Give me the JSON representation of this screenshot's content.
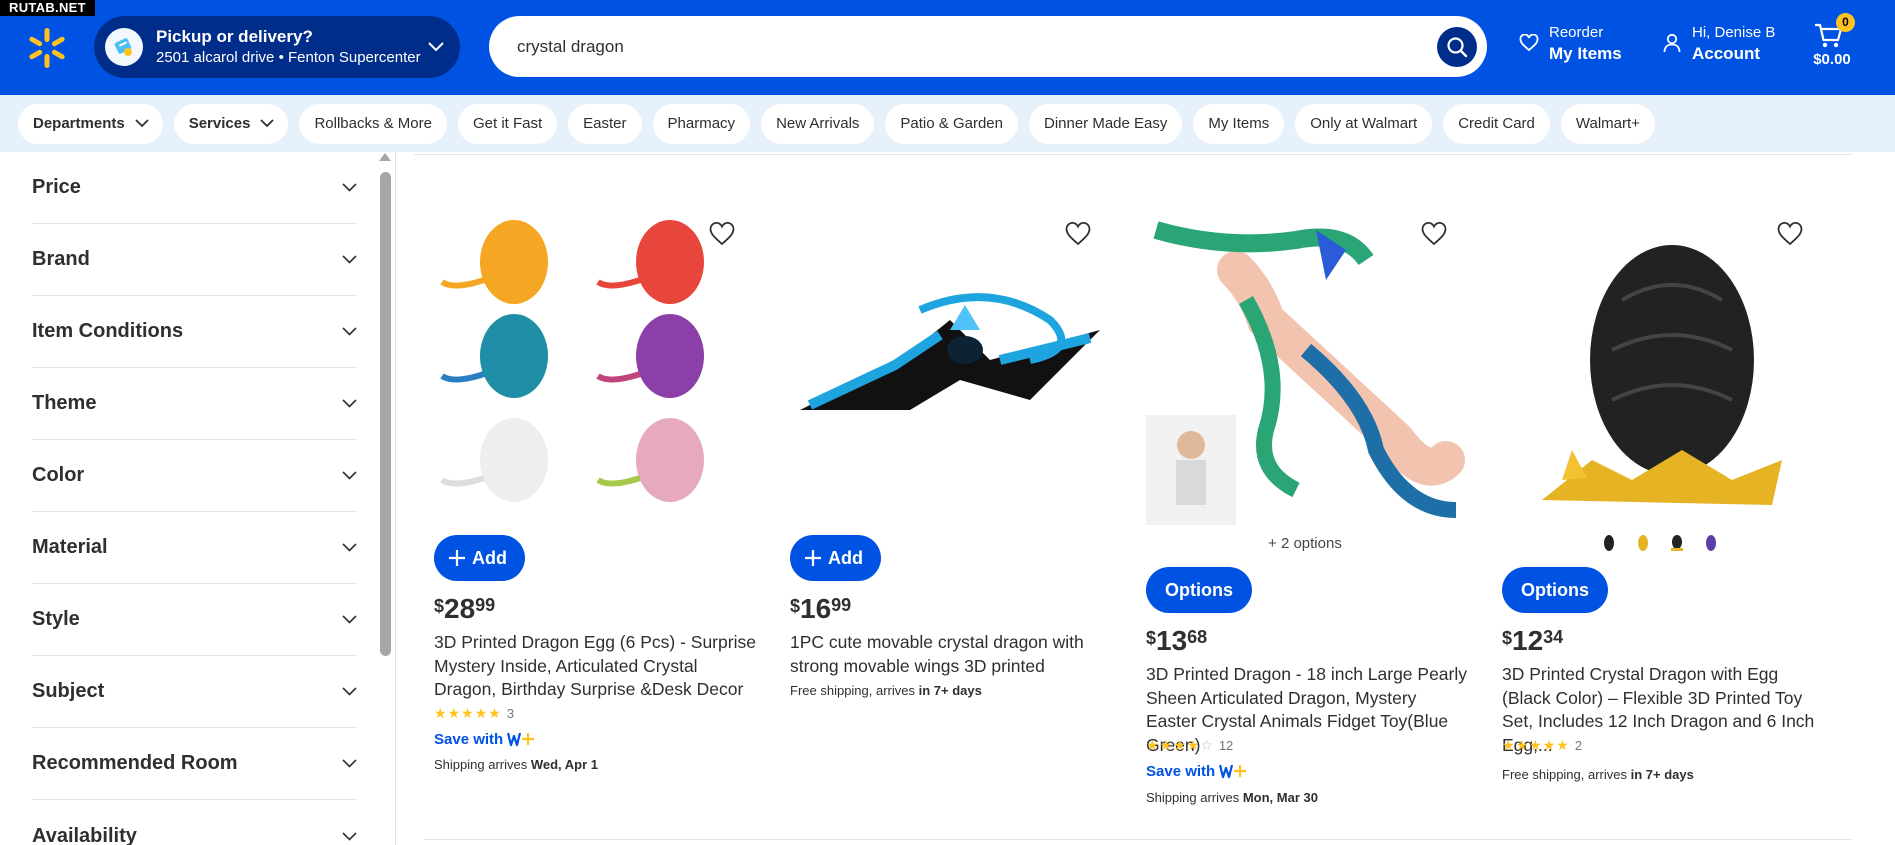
{
  "watermark": "RUTAB.NET",
  "header": {
    "pickup_title": "Pickup or delivery?",
    "pickup_sub": "2501 alcarol drive • Fenton Supercenter",
    "search_value": "crystal dragon",
    "reorder_small": "Reorder",
    "reorder_big": "My Items",
    "account_small": "Hi, Denise B",
    "account_big": "Account",
    "cart_count": "0",
    "cart_total": "$0.00",
    "brand_color": "#0053e2",
    "accent_color": "#ffc220"
  },
  "nav": {
    "departments": "Departments",
    "services": "Services",
    "pills": [
      "Rollbacks & More",
      "Get it Fast",
      "Easter",
      "Pharmacy",
      "New Arrivals",
      "Patio & Garden",
      "Dinner Made Easy",
      "My Items",
      "Only at Walmart",
      "Credit Card",
      "Walmart+"
    ]
  },
  "facets": [
    "Price",
    "Brand",
    "Item Conditions",
    "Theme",
    "Color",
    "Material",
    "Style",
    "Subject",
    "Recommended Room",
    "Availability"
  ],
  "products": [
    {
      "button": "Add",
      "price_currency": "$",
      "price_dollars": "28",
      "price_cents": "99",
      "title": "3D Printed Dragon Egg (6 Pcs) - Surprise Mystery Inside, Articulated Crystal Dragon, Birthday Surprise &Desk Decor",
      "rating": 5,
      "review_count": "3",
      "save_with": "Save with",
      "shipping_prefix": "Shipping arrives ",
      "shipping_date": "Wed, Apr 1"
    },
    {
      "button": "Add",
      "price_currency": "$",
      "price_dollars": "16",
      "price_cents": "99",
      "title": "1PC cute movable crystal dragon with strong movable wings 3D printed",
      "shipping_prefix": "Free shipping, arrives ",
      "shipping_date": "in 7+ days"
    },
    {
      "options_text": "2 options",
      "button": "Options",
      "price_currency": "$",
      "price_dollars": "13",
      "price_cents": "68",
      "title": "3D Printed Dragon - 18 inch Large Pearly Sheen Articulated Dragon, Mystery Easter Crystal Animals Fidget Toy(Blue Green)",
      "rating": 4,
      "review_count": "12",
      "save_with": "Save with",
      "shipping_prefix": "Shipping arrives ",
      "shipping_date": "Mon, Mar 30"
    },
    {
      "button": "Options",
      "price_currency": "$",
      "price_dollars": "12",
      "price_cents": "34",
      "title": "3D Printed Crystal Dragon with Egg (Black Color) – Flexible 3D Printed Toy Set, Includes 12 Inch Dragon and 6 Inch Egg,...",
      "rating": 5,
      "review_count": "2",
      "shipping_prefix": "Free shipping, arrives ",
      "shipping_date": "in 7+ days"
    }
  ]
}
